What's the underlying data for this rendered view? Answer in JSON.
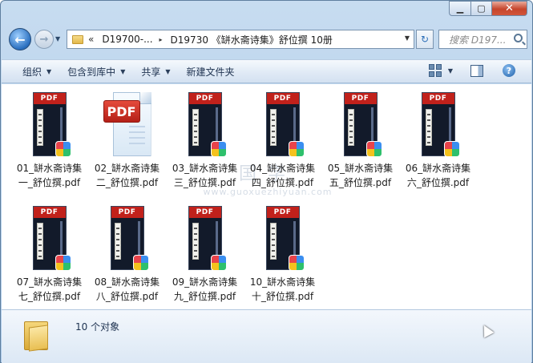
{
  "window": {
    "controls": {
      "minimize": "▁",
      "maximize": "▢",
      "close": "✕"
    }
  },
  "nav": {
    "back_glyph": "←",
    "forward_glyph": "→",
    "history_glyph": "▼",
    "breadcrumb_overflow": "«",
    "breadcrumbs": [
      "D19700-...",
      "D19730 《缾水斋诗集》舒位撰 10册"
    ],
    "breadcrumb_separator": "▸",
    "address_dropdown": "▼",
    "refresh_glyph": "↻",
    "search_placeholder": "搜索 D197..."
  },
  "toolbar": {
    "items": [
      {
        "label": "组织",
        "has_dropdown": true
      },
      {
        "label": "包含到库中",
        "has_dropdown": true
      },
      {
        "label": "共享",
        "has_dropdown": true
      },
      {
        "label": "新建文件夹",
        "has_dropdown": false
      }
    ],
    "dropdown_glyph": "▼",
    "help_glyph": "?"
  },
  "watermark": {
    "line1": "国学",
    "line2": "www.guoxuezhiyuan.com"
  },
  "files": [
    {
      "name_line1": "01_缾水斋诗集",
      "name_line2": "一_舒位撰.pdf",
      "icon": "pdf-book-icon"
    },
    {
      "name_line1": "02_缾水斋诗集",
      "name_line2": "二_舒位撰.pdf",
      "icon": "pdf-generic-icon"
    },
    {
      "name_line1": "03_缾水斋诗集",
      "name_line2": "三_舒位撰.pdf",
      "icon": "pdf-book-icon"
    },
    {
      "name_line1": "04_缾水斋诗集",
      "name_line2": "四_舒位撰.pdf",
      "icon": "pdf-book-icon"
    },
    {
      "name_line1": "05_缾水斋诗集",
      "name_line2": "五_舒位撰.pdf",
      "icon": "pdf-book-icon"
    },
    {
      "name_line1": "06_缾水斋诗集",
      "name_line2": "六_舒位撰.pdf",
      "icon": "pdf-book-icon"
    },
    {
      "name_line1": "07_缾水斋诗集",
      "name_line2": "七_舒位撰.pdf",
      "icon": "pdf-book-icon"
    },
    {
      "name_line1": "08_缾水斋诗集",
      "name_line2": "八_舒位撰.pdf",
      "icon": "pdf-book-icon"
    },
    {
      "name_line1": "09_缾水斋诗集",
      "name_line2": "九_舒位撰.pdf",
      "icon": "pdf-book-icon"
    },
    {
      "name_line1": "10_缾水斋诗集",
      "name_line2": "十_舒位撰.pdf",
      "icon": "pdf-book-icon"
    }
  ],
  "pdf_tag": "PDF",
  "status": {
    "count_text": "10 个对象"
  },
  "colors": {
    "pdf_red": "#c1211b",
    "book_dark": "#121a2a",
    "window_frame": "#a9c8e8"
  }
}
